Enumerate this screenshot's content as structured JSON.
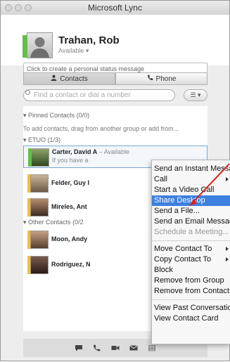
{
  "window": {
    "title": "Microsoft Lync"
  },
  "self": {
    "name": "Trahan, Rob",
    "status": "Available ▾",
    "status_placeholder": "Click to create a personal status message"
  },
  "tabs": [
    {
      "label": "Contacts"
    },
    {
      "label": "Phone"
    }
  ],
  "search": {
    "placeholder": "Find a contact or dial a number",
    "view_button": "☰ ▾"
  },
  "groups": {
    "pinned": {
      "label": "Pinned Contacts",
      "count": "(0/0)",
      "hint": "To add contacts, drag from another group or add from..."
    },
    "etuo": {
      "label": "ETUO",
      "count": "(1/3)"
    },
    "other": {
      "label": "Other Contacts",
      "count": "(0/2"
    }
  },
  "contacts": [
    {
      "name": "Carter, David A",
      "status": " – Available",
      "note": "If you have a",
      "presence_color": "#5ec243"
    },
    {
      "name": "Felder, Guy I",
      "status": "",
      "note": "",
      "presence_color": "#f2c12e"
    },
    {
      "name": "Mireles, Ant",
      "status": "",
      "note": "",
      "presence_color": "#f2c12e"
    },
    {
      "name": "Moon, Andy",
      "status": "",
      "note": "",
      "presence_color": "#f2c12e"
    },
    {
      "name": "Rodriguez, N",
      "status": "",
      "note": "",
      "presence_color": "#f2c12e"
    }
  ],
  "context_menu": {
    "items": [
      {
        "label": "Send an Instant Message"
      },
      {
        "label": "Call"
      },
      {
        "label": "Start a Video Call"
      },
      {
        "label": "Share Desktop"
      },
      {
        "label": "Send a File..."
      },
      {
        "label": "Send an Email Message..."
      },
      {
        "label": "Schedule a Meeting..."
      },
      {
        "label": "Move Contact To"
      },
      {
        "label": "Copy Contact To"
      },
      {
        "label": "Block"
      },
      {
        "label": "Remove from Group"
      },
      {
        "label": "Remove from Contacts List"
      },
      {
        "label": "View Past Conversations..."
      },
      {
        "label": "View Contact Card"
      }
    ]
  },
  "toolbar_icons": [
    "chat-icon",
    "phone-icon",
    "video-icon",
    "email-icon",
    "calendar-icon"
  ],
  "colors": {
    "highlight": "#3d80df",
    "annotation_arrow": "#e0201b"
  }
}
